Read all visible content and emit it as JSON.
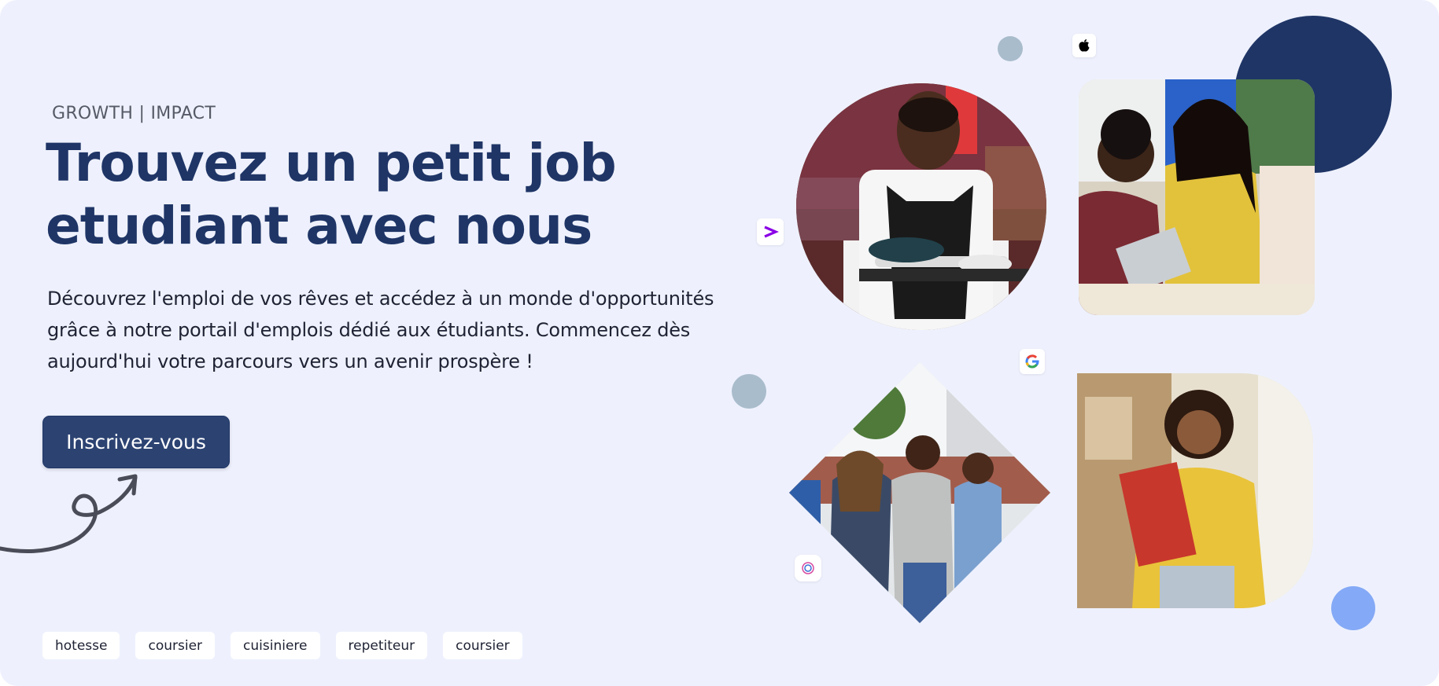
{
  "hero": {
    "eyebrow": "GROWTH | IMPACT",
    "headline_line1": "Trouvez un petit job",
    "headline_line2": "etudiant avec nous",
    "description_line1": "Découvrez l'emploi de vos rêves et accédez à un monde d'opportunités",
    "description_line2": "grâce à notre portail d'emplois dédié aux étudiants. Commencez dès",
    "description_line3": "aujourd'hui votre parcours vers un avenir prospère !",
    "cta_label": "Inscrivez-vous"
  },
  "tags": [
    "hotesse",
    "coursier",
    "cuisiniere",
    "repetiteur",
    "coursier"
  ],
  "logos": [
    "apple-logo",
    "accenture-logo",
    "google-logo",
    "small-brand-logo"
  ],
  "photos": [
    "waitress-photo",
    "students-laptop-photo",
    "students-walking-photo",
    "student-books-photo"
  ],
  "colors": {
    "background": "#eef1fd",
    "headline": "#1f3566",
    "cta": "#2c4372",
    "navy_circle": "#1f3566",
    "grey_dot": "#a9bccc",
    "blue_dot": "#84a9f6",
    "accent_purple": "#8a00e6"
  }
}
